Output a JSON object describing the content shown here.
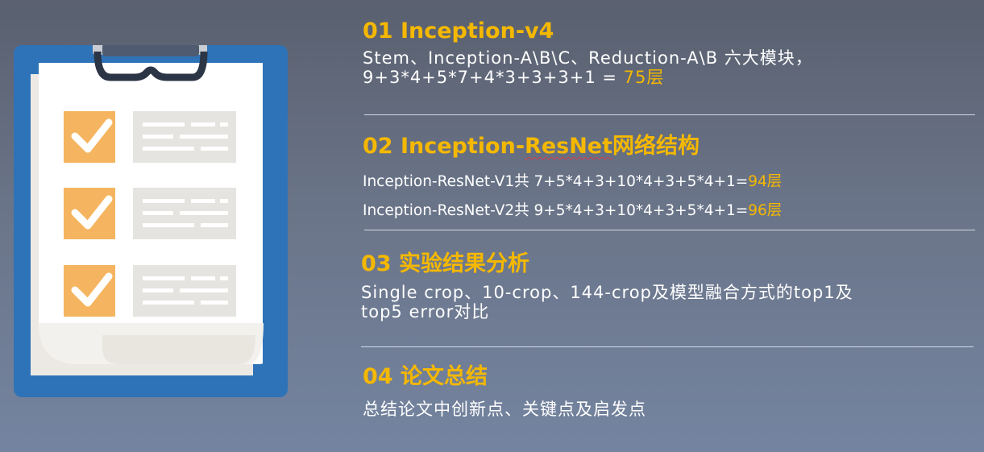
{
  "colors": {
    "accent": "#f5b800",
    "clipboard_blue": "#2e73b8",
    "check_orange": "#f5b560",
    "line_gray": "#e6e4e0"
  },
  "illustration": {
    "icon": "clipboard-checklist-icon"
  },
  "sections": [
    {
      "heading": "01 Inception-v4",
      "line1": "Stem、Inception-A\\B\\C、Reduction-A\\B 六大模块，",
      "line2_prefix": "9+3*4+5*7+4*3+3+3+1 = ",
      "line2_highlight": "75层"
    },
    {
      "heading_a": "02 Inception-",
      "heading_b": "ResNet",
      "heading_c": "网络结构",
      "row1_prefix": "Inception-ResNet-V1共 7+5*4+3+10*4+3+5*4+1=",
      "row1_highlight": "94层",
      "row2_prefix": "Inception-ResNet-V2共 9+5*4+3+10*4+3+5*4+1=",
      "row2_highlight": "96层"
    },
    {
      "heading": "03 实验结果分析",
      "line1": "Single crop、10-crop、144-crop及模型融合方式的top1及",
      "line2": "top5 error对比"
    },
    {
      "heading": "04 论文总结",
      "line1": "总结论文中创新点、关键点及启发点"
    }
  ]
}
